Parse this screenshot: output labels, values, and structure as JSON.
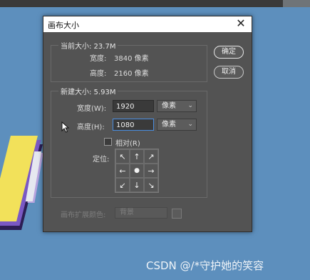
{
  "dialog": {
    "title": "画布大小",
    "close_symbol": "✕",
    "current_size": {
      "legend": "当前大小: 23.7M",
      "width_label": "宽度:",
      "width_value": "3840 像素",
      "height_label": "高度:",
      "height_value": "2160 像素"
    },
    "new_size": {
      "legend": "新建大小: 5.93M",
      "width_label": "宽度(W):",
      "width_value": "1920",
      "width_unit": "像素",
      "height_label": "高度(H):",
      "height_value": "1080",
      "height_unit": "像素",
      "relative_label": "相对(R)",
      "relative_checked": false,
      "anchor_label": "定位:",
      "anchor_cells": [
        "↖",
        "↑",
        "↗",
        "←",
        "●",
        "→",
        "↙",
        "↓",
        "↘"
      ]
    },
    "extension_color": {
      "label": "画布扩展颜色:",
      "value": "背景"
    },
    "buttons": {
      "ok": "确定",
      "cancel": "取消"
    }
  },
  "watermark": "CSDN @/*守护她的笑容",
  "colors": {
    "canvas_background": "#5d8fbd",
    "dialog_background": "#535353",
    "active_input_border": "#4a8ee0"
  }
}
